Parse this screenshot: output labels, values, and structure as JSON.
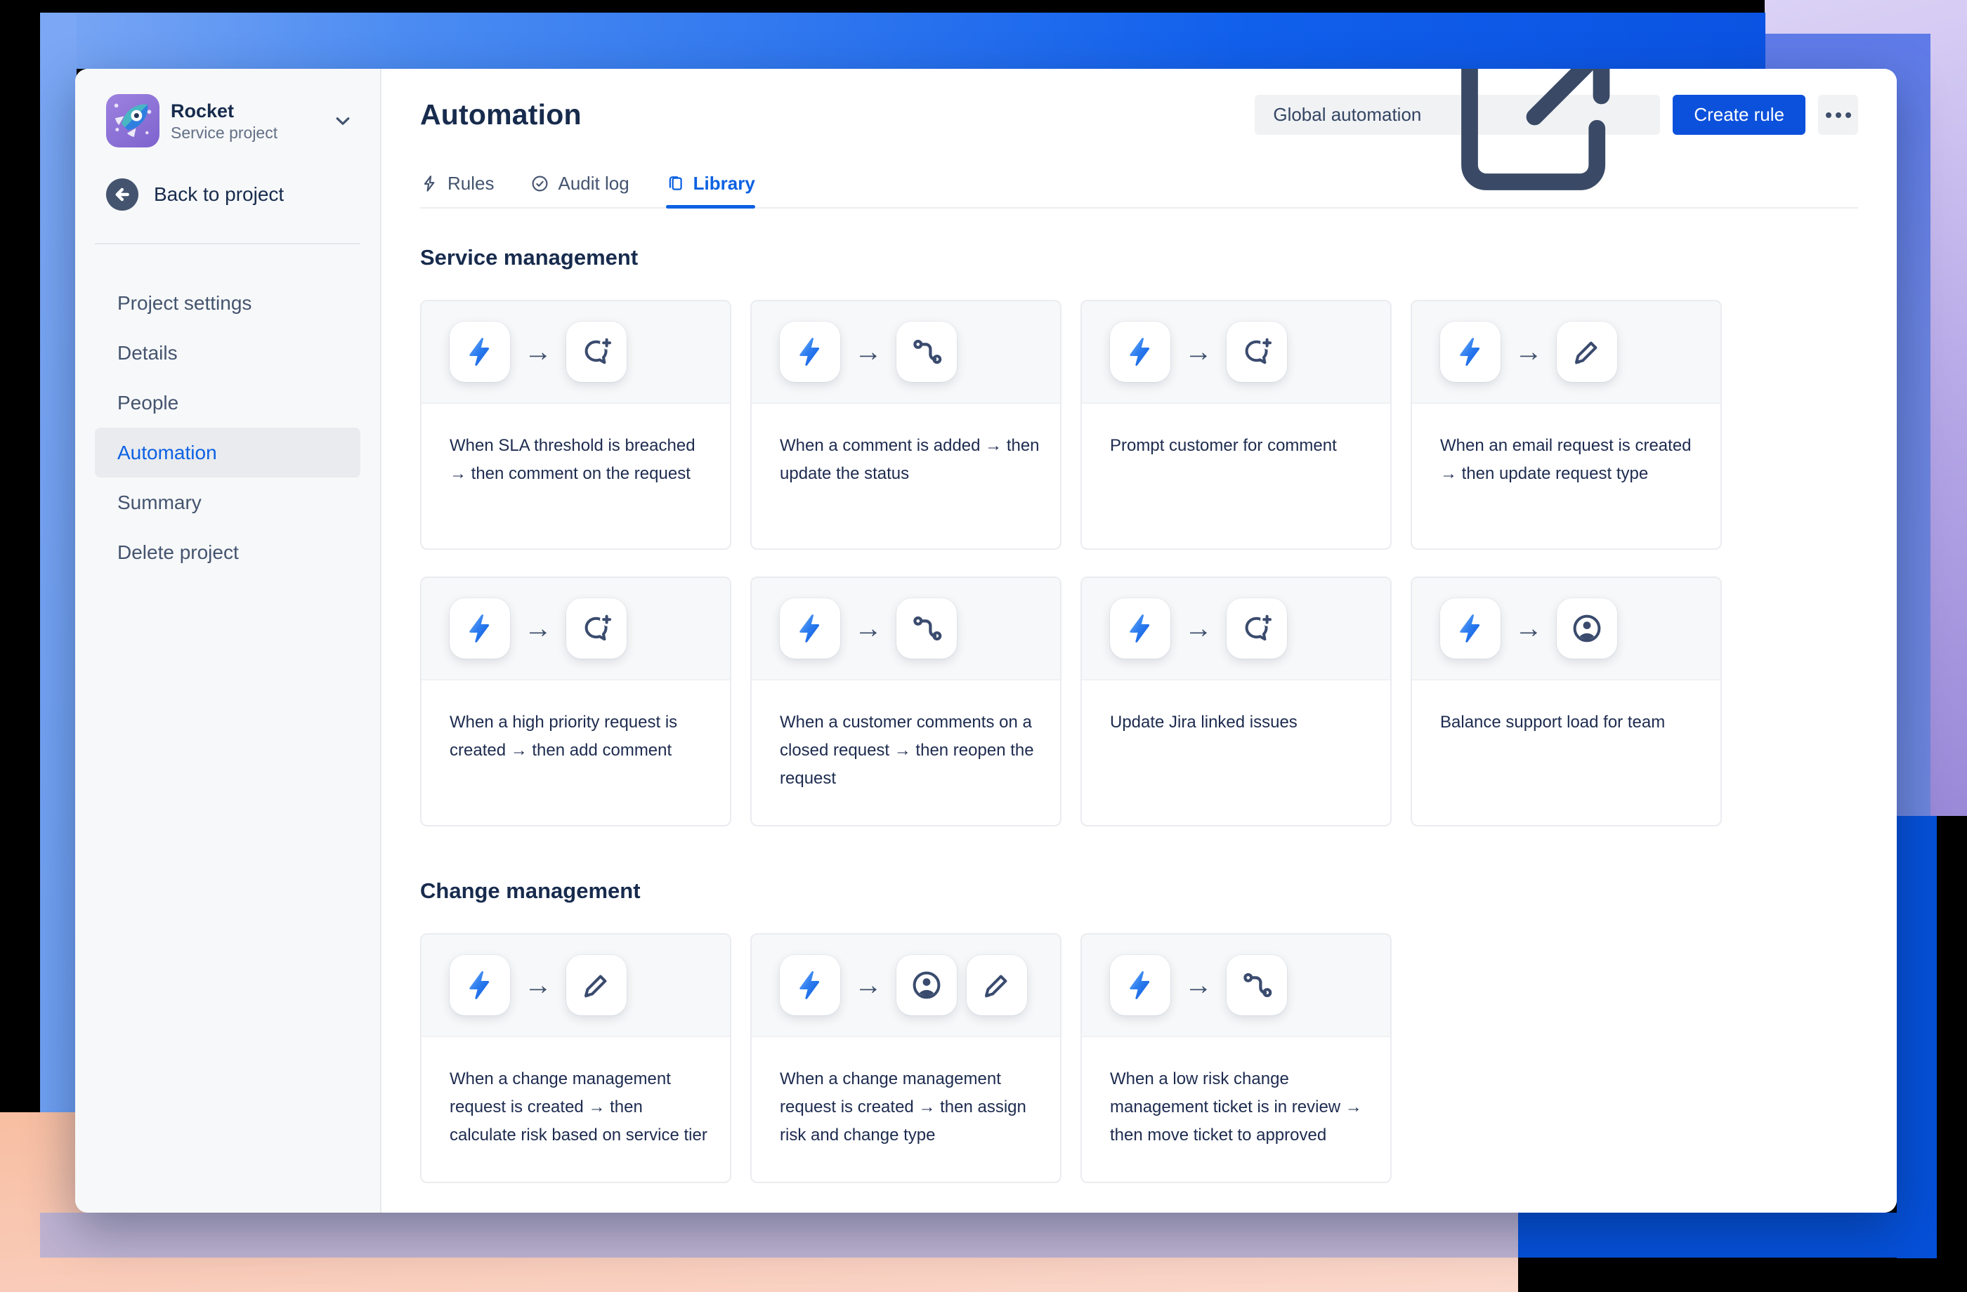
{
  "colors": {
    "accent": "#0C51DB",
    "tab_active": "#0B61E2",
    "nav_active": "#0C61E4",
    "text_navy": "#172B4D",
    "text_gray": "#626F86",
    "sidebar_bg": "#F7F8F9",
    "card_top_bg": "#F7F8F9",
    "card_border": "#EBECF0",
    "bolt_blue_light": "#7CB3F9",
    "bolt_blue_dark": "#0B57DF",
    "frame_blue": "#1160EC",
    "frame_cornflower": "#74A1F2",
    "frame_lavender": "#B4A5E6",
    "frame_periwinkle": "#6B84DF",
    "frame_peach": "#F8BEA1",
    "frame_mauve": "#BFB3D1",
    "frame_deep_blue": "#0550D8",
    "avatar_purple": "#8F73D6"
  },
  "sidebar": {
    "project_name": "Rocket",
    "project_type": "Service project",
    "avatar_icon": "rocket",
    "chevron_icon": "chevron-down",
    "back_icon": "arrow-left",
    "back_label": "Back to project",
    "items": [
      {
        "label": "Project settings",
        "active": false
      },
      {
        "label": "Details",
        "active": false
      },
      {
        "label": "People",
        "active": false
      },
      {
        "label": "Automation",
        "active": true
      },
      {
        "label": "Summary",
        "active": false
      },
      {
        "label": "Delete project",
        "active": false
      }
    ]
  },
  "header": {
    "title": "Automation",
    "global_automation_label": "Global automation",
    "global_automation_icon": "external-link",
    "create_rule_label": "Create rule",
    "more_icon": "ellipsis"
  },
  "tabs": [
    {
      "label": "Rules",
      "icon": "bolt-outline",
      "active": false
    },
    {
      "label": "Audit log",
      "icon": "check-circle",
      "active": false
    },
    {
      "label": "Library",
      "icon": "library-pages",
      "active": true
    }
  ],
  "sections": [
    {
      "title": "Service management",
      "cards": [
        {
          "icons": [
            "automation-bolt",
            "comment-add"
          ],
          "text": "When SLA threshold is breached → then comment on the request"
        },
        {
          "icons": [
            "automation-bolt",
            "workflow"
          ],
          "text": "When a comment is added → then update the status"
        },
        {
          "icons": [
            "automation-bolt",
            "comment-add"
          ],
          "text": "Prompt customer for comment"
        },
        {
          "icons": [
            "automation-bolt",
            "edit"
          ],
          "text": "When an email request is created → then update request type"
        },
        {
          "icons": [
            "automation-bolt",
            "comment-add"
          ],
          "text": "When a high priority request is created → then add comment"
        },
        {
          "icons": [
            "automation-bolt",
            "workflow"
          ],
          "text": "When a customer comments on a closed request → then reopen the request"
        },
        {
          "icons": [
            "automation-bolt",
            "comment-add"
          ],
          "text": "Update Jira linked issues"
        },
        {
          "icons": [
            "automation-bolt",
            "person"
          ],
          "text": "Balance support load for team"
        }
      ]
    },
    {
      "title": "Change management",
      "cards": [
        {
          "icons": [
            "automation-bolt",
            "edit"
          ],
          "text": "When a change management request is created → then calculate risk based on service tier"
        },
        {
          "icons": [
            "automation-bolt",
            "person",
            "edit"
          ],
          "text": "When a change management request is created → then assign risk and change type"
        },
        {
          "icons": [
            "automation-bolt",
            "workflow"
          ],
          "text": "When a low risk change management ticket is in review → then move ticket to approved"
        }
      ]
    }
  ],
  "card_arrow_glyph": "→"
}
